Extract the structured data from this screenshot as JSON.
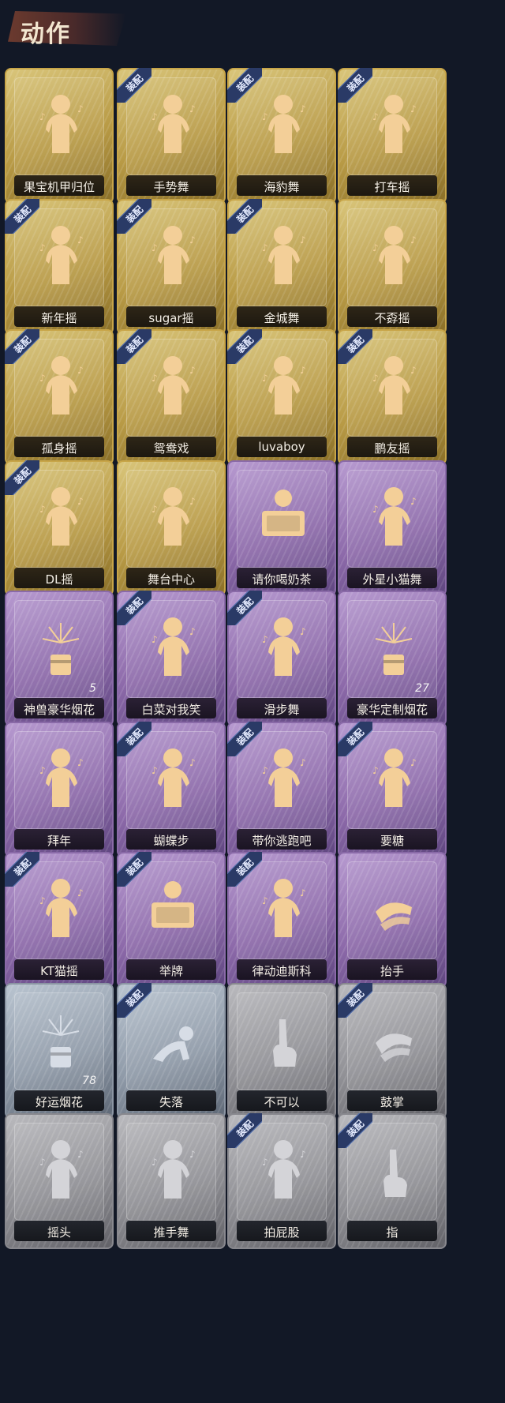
{
  "header": {
    "title": "动作"
  },
  "equip_label": "装配",
  "items": [
    {
      "name": "果宝机甲归位",
      "rarity": "gold",
      "equipped": false,
      "icon": "pose-figure-icon"
    },
    {
      "name": "手势舞",
      "rarity": "gold",
      "equipped": true,
      "icon": "dance-figure-icon"
    },
    {
      "name": "海豹舞",
      "rarity": "gold",
      "equipped": true,
      "icon": "dance-figure-icon"
    },
    {
      "name": "打车摇",
      "rarity": "gold",
      "equipped": true,
      "icon": "dance-figure-icon"
    },
    {
      "name": "新年摇",
      "rarity": "gold",
      "equipped": true,
      "icon": "dance-figure-icon"
    },
    {
      "name": "sugar摇",
      "rarity": "gold",
      "equipped": true,
      "icon": "dance-figure-icon"
    },
    {
      "name": "金城舞",
      "rarity": "gold",
      "equipped": true,
      "icon": "dance-figure-icon"
    },
    {
      "name": "不孬摇",
      "rarity": "gold",
      "equipped": false,
      "icon": "dance-figure-icon"
    },
    {
      "name": "孤身摇",
      "rarity": "gold",
      "equipped": true,
      "icon": "dance-figure-icon"
    },
    {
      "name": "鸳鸯戏",
      "rarity": "gold",
      "equipped": true,
      "icon": "dance-figure-icon"
    },
    {
      "name": "luvaboy",
      "rarity": "gold",
      "equipped": true,
      "icon": "dance-figure-icon"
    },
    {
      "name": "鹏友摇",
      "rarity": "gold",
      "equipped": true,
      "icon": "dance-figure-icon"
    },
    {
      "name": "DL摇",
      "rarity": "gold",
      "equipped": true,
      "icon": "dance-figure-icon"
    },
    {
      "name": "舞台中心",
      "rarity": "gold",
      "equipped": false,
      "icon": "dance-figure-icon"
    },
    {
      "name": "请你喝奶茶",
      "rarity": "purple",
      "equipped": false,
      "icon": "sign-figure-icon"
    },
    {
      "name": "外星小猫舞",
      "rarity": "purple",
      "equipped": false,
      "icon": "dance-figure-icon"
    },
    {
      "name": "神兽豪华烟花",
      "rarity": "purple",
      "equipped": false,
      "icon": "firework-icon",
      "count": "5"
    },
    {
      "name": "白菜对我笑",
      "rarity": "purple",
      "equipped": true,
      "icon": "dance-figure-icon"
    },
    {
      "name": "滑步舞",
      "rarity": "purple",
      "equipped": true,
      "icon": "dance-figure-icon"
    },
    {
      "name": "豪华定制烟花",
      "rarity": "purple",
      "equipped": false,
      "icon": "firework-icon",
      "count": "27"
    },
    {
      "name": "拜年",
      "rarity": "purple",
      "equipped": false,
      "icon": "greeting-figure-icon"
    },
    {
      "name": "蝴蝶步",
      "rarity": "purple",
      "equipped": true,
      "icon": "dance-figure-icon"
    },
    {
      "name": "带你逃跑吧",
      "rarity": "purple",
      "equipped": true,
      "icon": "dance-figure-icon"
    },
    {
      "name": "要糖",
      "rarity": "purple",
      "equipped": true,
      "icon": "reach-figure-icon"
    },
    {
      "name": "KT猫摇",
      "rarity": "purple",
      "equipped": true,
      "icon": "dance-figure-icon"
    },
    {
      "name": "举牌",
      "rarity": "purple",
      "equipped": true,
      "icon": "sign-figure-icon"
    },
    {
      "name": "律动迪斯科",
      "rarity": "purple",
      "equipped": true,
      "icon": "dance-figure-icon"
    },
    {
      "name": "抬手",
      "rarity": "purple",
      "equipped": false,
      "icon": "hand-icon"
    },
    {
      "name": "好运烟花",
      "rarity": "silver",
      "equipped": false,
      "icon": "firework-icon",
      "count": "78"
    },
    {
      "name": "失落",
      "rarity": "silver",
      "equipped": true,
      "icon": "crawl-figure-icon"
    },
    {
      "name": "不可以",
      "rarity": "grey",
      "equipped": false,
      "icon": "finger-icon"
    },
    {
      "name": "鼓掌",
      "rarity": "grey",
      "equipped": true,
      "icon": "clap-icon"
    },
    {
      "name": "摇头",
      "rarity": "grey",
      "equipped": false,
      "icon": "pose-figure-icon"
    },
    {
      "name": "推手舞",
      "rarity": "grey",
      "equipped": false,
      "icon": "pose-figure-icon"
    },
    {
      "name": "拍屁股",
      "rarity": "grey",
      "equipped": true,
      "icon": "pose-figure-icon"
    },
    {
      "name": "指",
      "rarity": "grey",
      "equipped": true,
      "icon": "point-icon"
    }
  ]
}
